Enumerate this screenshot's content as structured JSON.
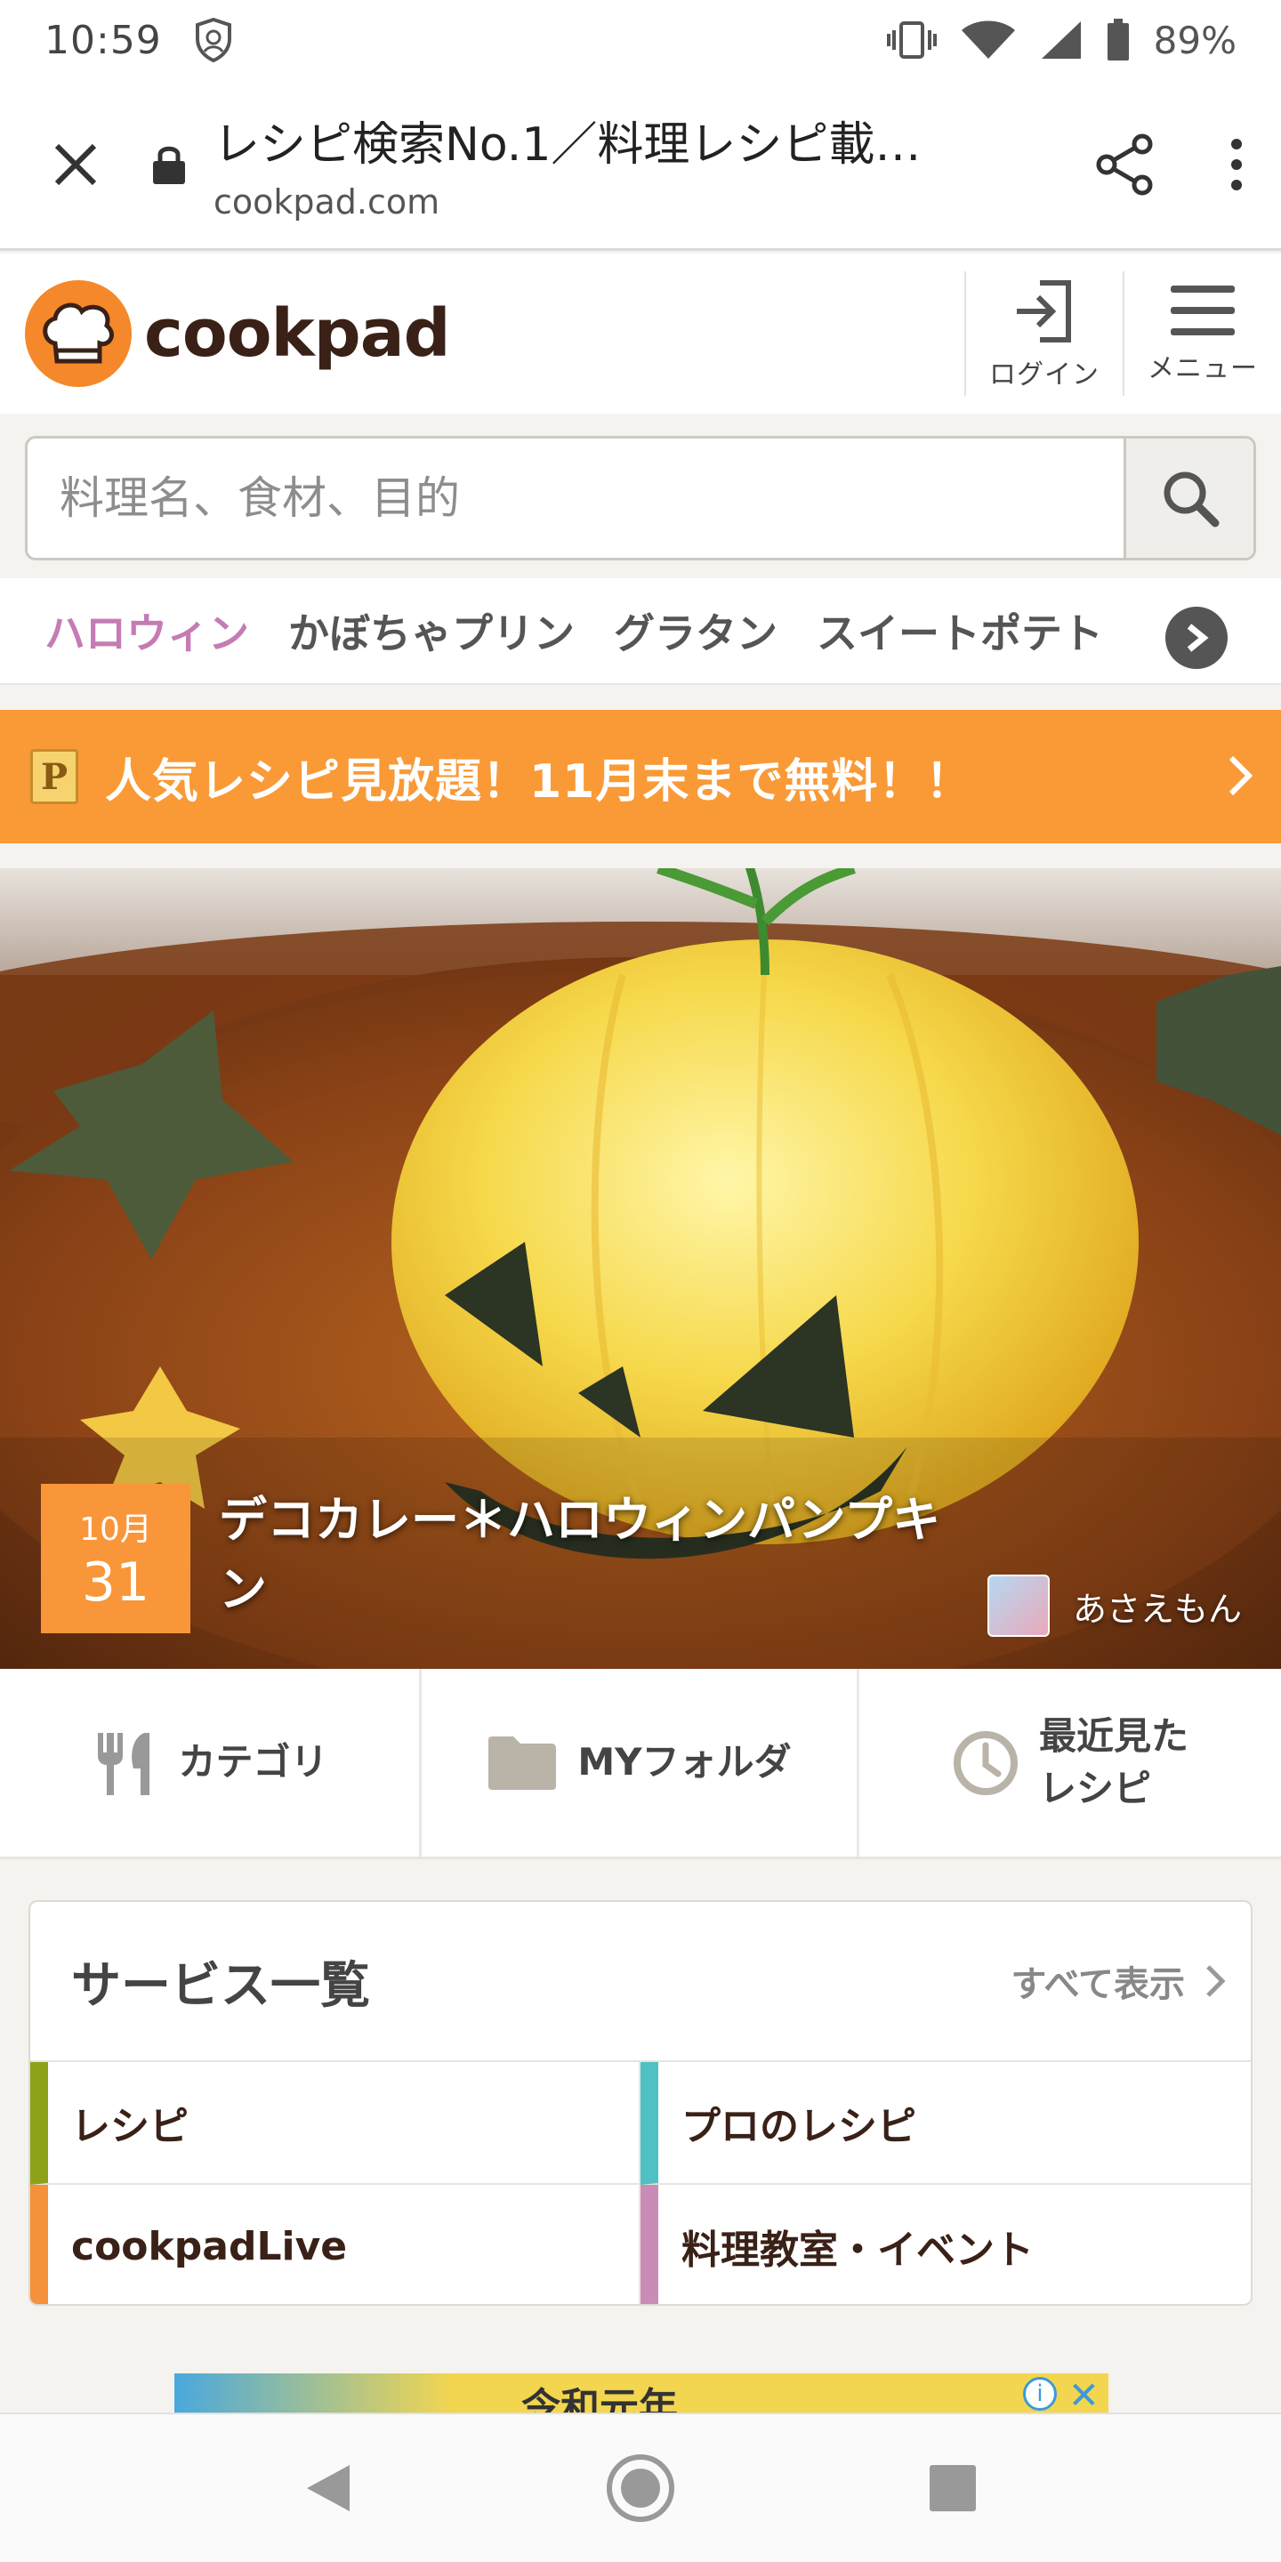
{
  "status_bar": {
    "time": "10:59",
    "battery": "89%"
  },
  "browser": {
    "title": "レシピ検索No.1／料理レシピ載…",
    "url": "cookpad.com"
  },
  "header": {
    "logo_text": "cookpad",
    "login_label": "ログイン",
    "menu_label": "メニュー"
  },
  "search": {
    "placeholder": "料理名、食材、目的"
  },
  "keywords": [
    "ハロウィン",
    "かぼちゃプリン",
    "グラタン",
    "スイートポテト"
  ],
  "promo": {
    "text": "人気レシピ見放題！11月末まで無料！！",
    "badge": "P"
  },
  "hero": {
    "month": "10月",
    "day": "31",
    "title": "デコカレー＊ハロウィンパンプキン",
    "author": "あさえもん"
  },
  "quicknav": {
    "category": "カテゴリ",
    "my_folder": "MYフォルダ",
    "recent": "最近見た\nレシピ"
  },
  "services": {
    "title": "サービス一覧",
    "see_all": "すべて表示",
    "items": [
      {
        "label": "レシピ",
        "color": "#8fa11b"
      },
      {
        "label": "プロのレシピ",
        "color": "#4fc0c4"
      },
      {
        "label": "cookpadLive",
        "color": "#f5913a"
      },
      {
        "label": "料理教室・イベント",
        "color": "#c98cb7"
      }
    ]
  },
  "ad": {
    "text": "令和元年"
  },
  "colors": {
    "brand": "#f5882a",
    "promo": "#f99a36",
    "accent_pink": "#c57bb4"
  }
}
